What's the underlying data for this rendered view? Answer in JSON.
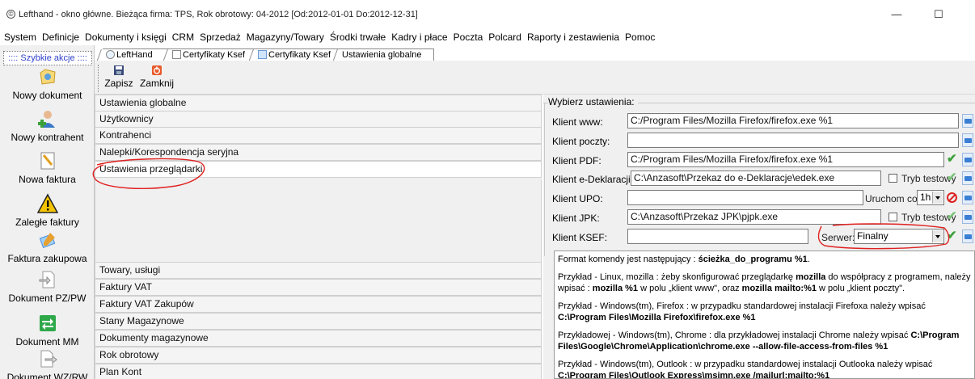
{
  "window": {
    "title": "Lefthand - okno główne. Bieżąca firma: TPS, Rok obrotowy: 04-2012 [Od:2012-01-01 Do:2012-12-31]",
    "minimize": "—",
    "maximize": "☐"
  },
  "menu": [
    "System",
    "Definicje",
    "Dokumenty i księgi",
    "CRM",
    "Sprzedaż",
    "Magazyny/Towary",
    "Środki trwałe",
    "Kadry i płace",
    "Poczta",
    "Polcard",
    "Raporty i zestawienia",
    "Pomoc"
  ],
  "sidebar": {
    "header": ":::: Szybkie akcje ::::",
    "items": [
      {
        "label": "Nowy dokument",
        "icon": "new-document-icon"
      },
      {
        "label": "Nowy kontrahent",
        "icon": "new-contractor-icon"
      },
      {
        "label": "Nowa faktura",
        "icon": "new-invoice-icon"
      },
      {
        "label": "Zaległe faktury",
        "icon": "warning-icon"
      },
      {
        "label": "Faktura zakupowa",
        "icon": "purchase-invoice-icon"
      },
      {
        "label": "Dokument PZ/PW",
        "icon": "document-pz-icon"
      },
      {
        "label": "Dokument MM",
        "icon": "document-mm-icon"
      },
      {
        "label": "Dokument WZ/RW",
        "icon": "document-wz-icon"
      }
    ]
  },
  "tabs": [
    "LeftHand",
    "Certyfikaty Ksef",
    "Certyfikaty Ksef",
    "Ustawienia globalne"
  ],
  "toolbar": {
    "save": "Zapisz",
    "close": "Zamknij"
  },
  "settings_list": {
    "top": [
      "Ustawienia globalne",
      "Użytkownicy",
      "Kontrahenci",
      "Nalepki/Korespondencja seryjna",
      "Ustawienia przeglądarki"
    ],
    "bottom": [
      "Towary, usługi",
      "Faktury VAT",
      "Faktury VAT Zakupów",
      "Stany Magazynowe",
      "Dokumenty magazynowe",
      "Rok obrotowy",
      "Plan Kont"
    ]
  },
  "right": {
    "group_title": "Wybierz ustawienia:",
    "klient_www": {
      "label": "Klient www:",
      "value": "C:/Program Files/Mozilla Firefox/firefox.exe %1"
    },
    "klient_poczty": {
      "label": "Klient poczty:",
      "value": ""
    },
    "klient_pdf": {
      "label": "Klient PDF:",
      "value": "C:/Program Files/Mozilla Firefox/firefox.exe %1"
    },
    "klient_edeklaracji": {
      "label": "Klient e-Deklaracji:",
      "value": "C:\\Anzasoft\\Przekaz do e-Deklaracje\\edek.exe",
      "test_mode": "Tryb testowy"
    },
    "klient_upo": {
      "label": "Klient UPO:",
      "value": "",
      "run_label": "Uruchom co:",
      "run_value": "1h"
    },
    "klient_jpk": {
      "label": "Klient JPK:",
      "value": "C:\\Anzasoft\\Przekaz JPK\\pjpk.exe",
      "test_mode": "Tryb testowy"
    },
    "klient_ksef": {
      "label": "Klient KSEF:",
      "value": "",
      "server_label": "Serwer:",
      "server_value": "Finalny"
    }
  },
  "help": {
    "p1_a": "Format komendy jest następujący : ",
    "p1_b": "ścieżka_do_programu %1",
    "p1_c": ".",
    "p2_a": "Przykład - Linux, mozilla : żeby skonfigurować przeglądarkę ",
    "p2_b": "mozilla",
    "p2_c": " do współpracy z programem, należy wpisać : ",
    "p2_d": "mozilla %1",
    "p2_e": " w polu „klient www\", oraz ",
    "p2_f": "mozilla mailto:%1",
    "p2_g": " w polu „klient poczty\".",
    "p3_a": "Przykład - Windows(tm), Firefox : w przypadku standardowej instalacji Firefoxa należy wpisać ",
    "p3_b": "C:\\Program Files\\Mozilla Firefox\\firefox.exe %1",
    "p4_a": "Przykładowej - Windows(tm), Chrome : dla przykładowej instalacji Chrome należy wpisać ",
    "p4_b": "C:\\Program Files\\Google\\Chrome\\Application\\chrome.exe --allow-file-access-from-files %1",
    "p5_a": "Przykład - Windows(tm), Outlook : w przypadku standardowej instalacji Outlooka należy wpisać ",
    "p5_b": "C:\\Program Files\\Outlook Express\\msimn.exe /mailurl:mailto:%1"
  },
  "colors": {
    "accent": "#3344cc",
    "annotation": "#e02020",
    "ok": "#3aa13a",
    "stop": "#dd2222"
  }
}
